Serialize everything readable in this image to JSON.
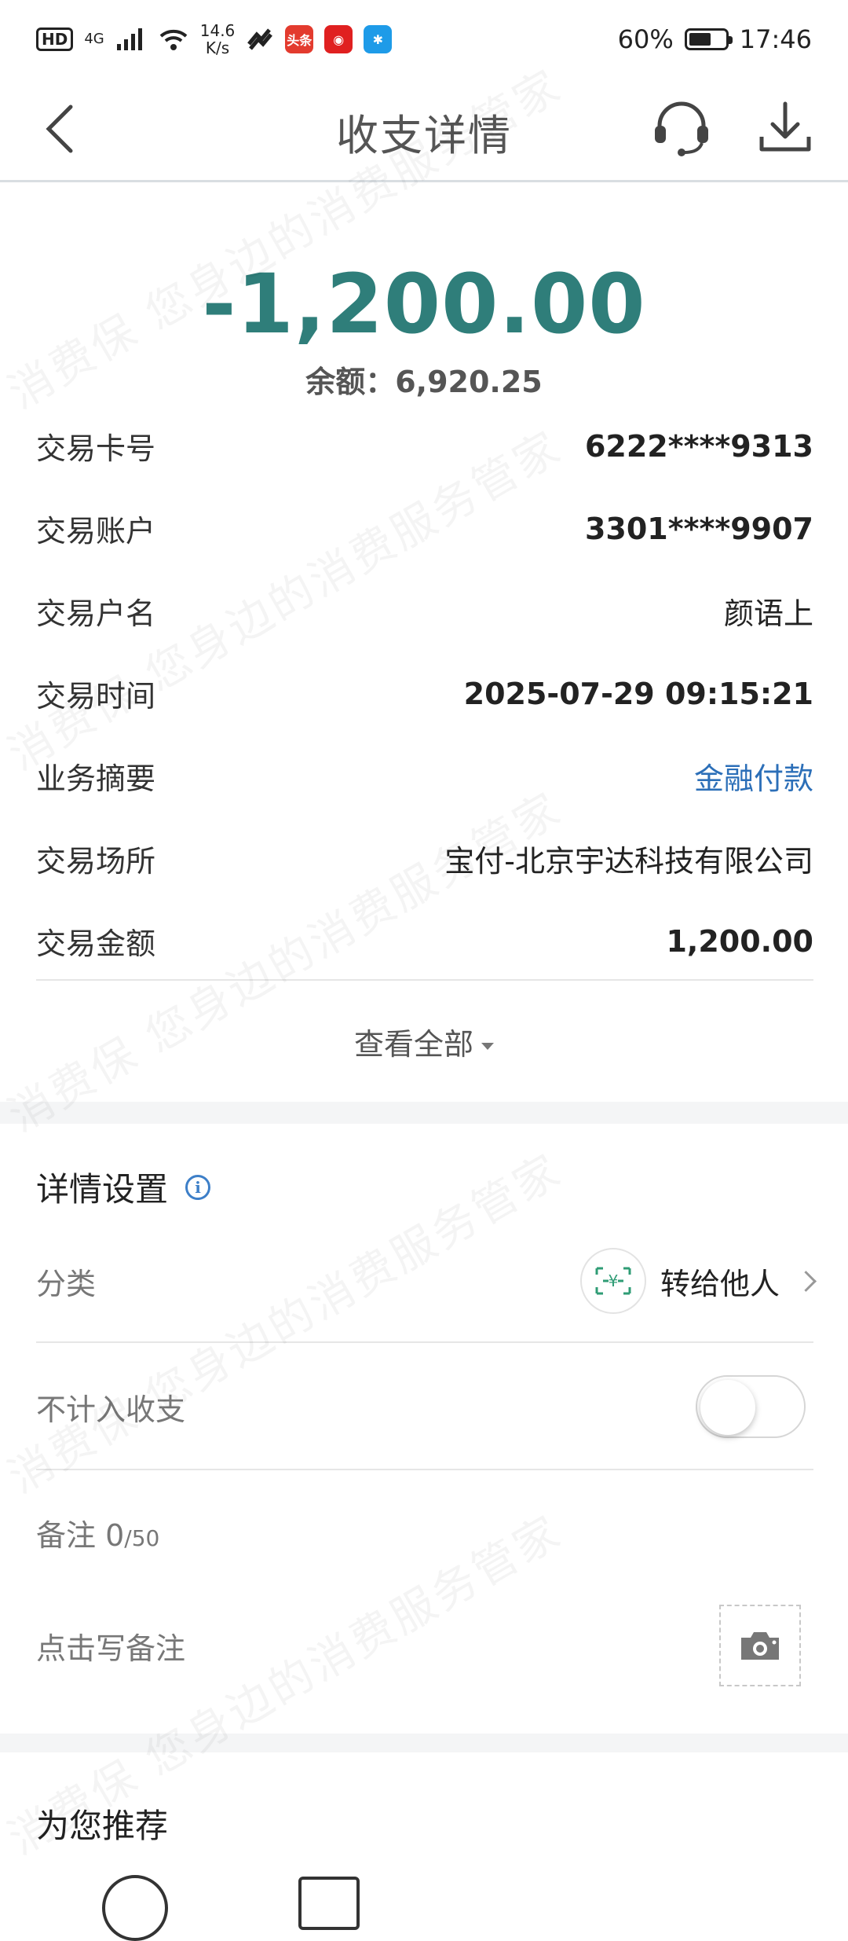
{
  "status_bar": {
    "hd": "HD",
    "network": "4G",
    "speed_value": "14.6",
    "speed_unit": "K/s",
    "app_badge_1": "头条",
    "battery_percent": "60%",
    "time": "17:46"
  },
  "header": {
    "title": "收支详情"
  },
  "transaction": {
    "amount": "-1,200.00",
    "balance": "余额：6,920.25",
    "rows": [
      {
        "label": "交易卡号",
        "value": "6222****9313"
      },
      {
        "label": "交易账户",
        "value": "3301****9907"
      },
      {
        "label": "交易户名",
        "value": "颜语上"
      },
      {
        "label": "交易时间",
        "value": "2025-07-29 09:15:21"
      },
      {
        "label": "业务摘要",
        "value": "金融付款"
      },
      {
        "label": "交易场所",
        "value": "宝付-北京宇达科技有限公司"
      },
      {
        "label": "交易金额",
        "value": "1,200.00"
      }
    ],
    "view_all": "查看全部"
  },
  "settings": {
    "title": "详情设置",
    "category_label": "分类",
    "category_value": "转给他人",
    "exclude_label": "不计入收支",
    "exclude_enabled": false,
    "note_label": "备注",
    "note_count": "0",
    "note_max": "/50",
    "note_placeholder": "点击写备注"
  },
  "recommend": {
    "title": "为您推荐"
  },
  "watermark": {
    "text_1": "消费保 您身边的消费服务管家"
  },
  "colors": {
    "amount": "#2f7e7a",
    "link": "#2c6fb8",
    "band": "#f4f5f6"
  }
}
